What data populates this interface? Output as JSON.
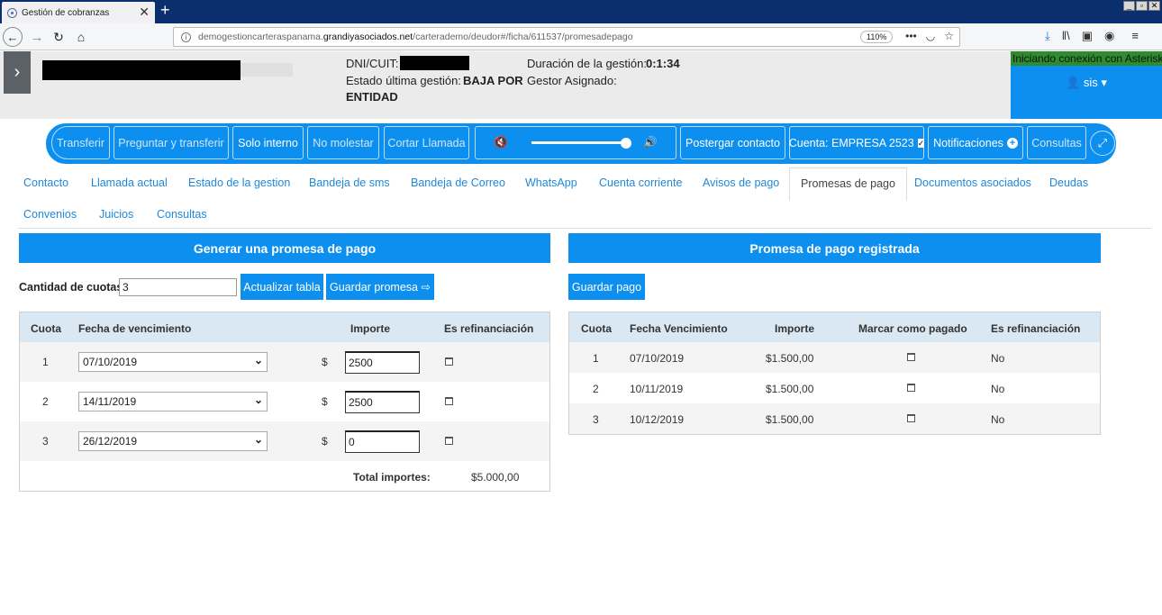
{
  "browser": {
    "tab_title": "Gestión de cobranzas",
    "url_prefix": "demogestioncarteraspanama.",
    "url_domain": "grandiyasociados.net",
    "url_path": "/carterademo/deudor#/ficha/611537/promesadepago",
    "zoom": "110%"
  },
  "header": {
    "dni_label": "DNI/CUIT:",
    "estado_label": "Estado última gestión:",
    "estado_value_1": "BAJA POR",
    "estado_value_2": "ENTIDAD",
    "duracion_label": "Duración de la gestión:",
    "duracion_value": "0:1:34",
    "gestor_label": "Gestor Asignado:",
    "asterisk_status": "Iniciando conexión con Asterisk",
    "user": "sis"
  },
  "toolbar": {
    "transferir": "Transferir",
    "preguntar": "Preguntar y transferir",
    "solo_interno": "Solo interno",
    "no_molestar": "No molestar",
    "cortar": "Cortar Llamada",
    "postergar": "Postergar contacto",
    "cuenta": "Cuenta: EMPRESA 2523",
    "notificaciones": "Notificaciones",
    "consultas": "Consultas",
    "volume_level": 0.95
  },
  "tabs": [
    "Contacto",
    "Llamada actual",
    "Estado de la gestion",
    "Bandeja de sms",
    "Bandeja de Correo",
    "WhatsApp",
    "Cuenta corriente",
    "Avisos de pago",
    "Promesas de pago",
    "Documentos asociados",
    "Deudas",
    "Convenios",
    "Juicios",
    "Consultas"
  ],
  "left": {
    "title": "Generar una promesa de pago",
    "cuotas_label": "Cantidad de cuotas",
    "cuotas_value": "3",
    "btn_actualizar": "Actualizar tabla",
    "btn_guardar": "Guardar promesa",
    "columns": [
      "Cuota",
      "Fecha de vencimiento",
      "Importe",
      "Es refinanciación"
    ],
    "rows": [
      {
        "cuota": "1",
        "fecha": "07/10/2019",
        "currency": "$",
        "importe": "2500"
      },
      {
        "cuota": "2",
        "fecha": "14/11/2019",
        "currency": "$",
        "importe": "2500"
      },
      {
        "cuota": "3",
        "fecha": "26/12/2019",
        "currency": "$",
        "importe": "0"
      }
    ],
    "total_label": "Total importes:",
    "total_value": "$5.000,00"
  },
  "right": {
    "title": "Promesa de pago registrada",
    "btn_guardar_pago": "Guardar pago",
    "columns": [
      "Cuota",
      "Fecha Vencimiento",
      "Importe",
      "Marcar como pagado",
      "Es refinanciación"
    ],
    "rows": [
      {
        "cuota": "1",
        "fecha": "07/10/2019",
        "importe": "$1.500,00",
        "refin": "No"
      },
      {
        "cuota": "2",
        "fecha": "10/11/2019",
        "importe": "$1.500,00",
        "refin": "No"
      },
      {
        "cuota": "3",
        "fecha": "10/12/2019",
        "importe": "$1.500,00",
        "refin": "No"
      }
    ]
  }
}
